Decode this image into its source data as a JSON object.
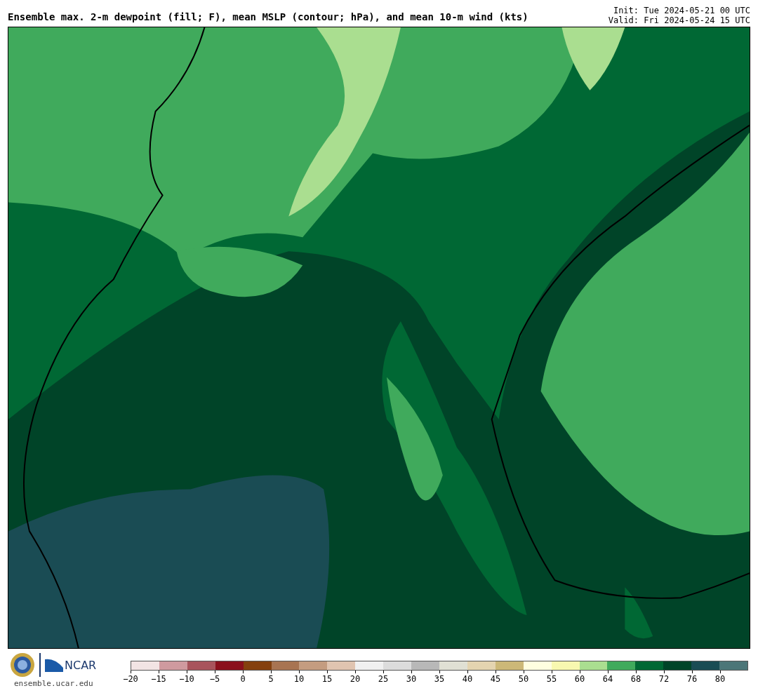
{
  "header": {
    "title": "Ensemble max. 2-m dewpoint (fill; F), mean MSLP (contour; hPa), and mean 10-m wind (kts)",
    "init": "Init: Tue 2024-05-21 00 UTC",
    "valid": "Valid: Fri 2024-05-24 15 UTC"
  },
  "footer": {
    "site": "ensemble.ucar.edu",
    "logo_text": "NCAR"
  },
  "colorbar": {
    "segments": [
      {
        "color": "#f2e4e4"
      },
      {
        "color": "#cf9a9f"
      },
      {
        "color": "#a8545c"
      },
      {
        "color": "#8a101c"
      },
      {
        "color": "#84400e"
      },
      {
        "color": "#a87452"
      },
      {
        "color": "#c49c80"
      },
      {
        "color": "#e0c4b0"
      },
      {
        "color": "#f0f0f0"
      },
      {
        "color": "#dcdcdc"
      },
      {
        "color": "#b8b8b8"
      },
      {
        "color": "#e0e0d4"
      },
      {
        "color": "#e4d4b0"
      },
      {
        "color": "#ccb878"
      },
      {
        "color": "#fefee0"
      },
      {
        "color": "#f8f8b0"
      },
      {
        "color": "#aade90"
      },
      {
        "color": "#40aa5c"
      },
      {
        "color": "#006834"
      },
      {
        "color": "#004428"
      },
      {
        "color": "#1a4c54"
      },
      {
        "color": "#4c7678"
      }
    ],
    "ticks": [
      "−20",
      "−15",
      "−10",
      "−5",
      "0",
      "5",
      "10",
      "15",
      "20",
      "25",
      "30",
      "35",
      "40",
      "45",
      "50",
      "55",
      "60",
      "64",
      "68",
      "72",
      "76",
      "80"
    ]
  }
}
